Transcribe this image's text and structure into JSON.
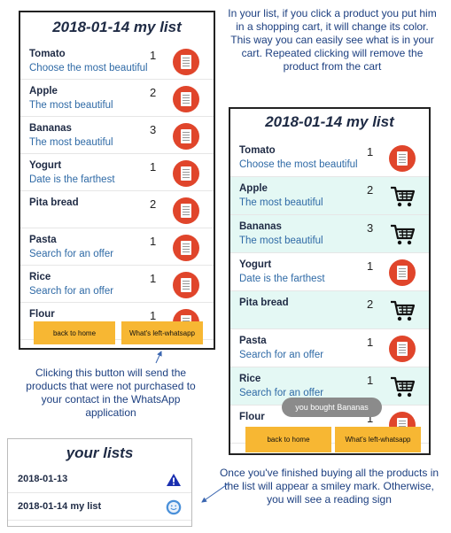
{
  "colors": {
    "incart_bg": "#e4f8f4",
    "button": "#f7b733",
    "doc_icon": "#e0452b",
    "annotation": "#1c3f80",
    "title": "#1e2a44",
    "note": "#2f6aa6"
  },
  "left_phone": {
    "title": "2018-01-14  my list",
    "items": [
      {
        "name": "Tomato",
        "note": "Choose the most beautiful",
        "qty": "1",
        "icon": "doc-icon"
      },
      {
        "name": "Apple",
        "note": "The most beautiful",
        "qty": "2",
        "icon": "doc-icon"
      },
      {
        "name": "Bananas",
        "note": "The most beautiful",
        "qty": "3",
        "icon": "doc-icon"
      },
      {
        "name": "Yogurt",
        "note": "Date is the farthest",
        "qty": "1",
        "icon": "doc-icon"
      },
      {
        "name": "Pita bread",
        "note": "",
        "qty": "2",
        "icon": "doc-icon"
      },
      {
        "name": "Pasta",
        "note": "Search for an offer",
        "qty": "1",
        "icon": "doc-icon"
      },
      {
        "name": "Rice",
        "note": "Search for an offer",
        "qty": "1",
        "icon": "doc-icon"
      },
      {
        "name": "Flour",
        "note": "",
        "qty": "1",
        "icon": "doc-icon"
      }
    ],
    "buttons": {
      "home": "back to home",
      "whatsapp": "What's left-whatsapp"
    }
  },
  "right_phone": {
    "title": "2018-01-14  my list",
    "items": [
      {
        "name": "Tomato",
        "note": "Choose the most beautiful",
        "qty": "1",
        "icon": "doc-icon",
        "in_cart": false
      },
      {
        "name": "Apple",
        "note": "The most beautiful",
        "qty": "2",
        "icon": "cart-icon",
        "in_cart": true
      },
      {
        "name": "Bananas",
        "note": "The most beautiful",
        "qty": "3",
        "icon": "cart-icon",
        "in_cart": true
      },
      {
        "name": "Yogurt",
        "note": "Date is the farthest",
        "qty": "1",
        "icon": "doc-icon",
        "in_cart": false
      },
      {
        "name": "Pita bread",
        "note": "",
        "qty": "2",
        "icon": "cart-icon",
        "in_cart": true
      },
      {
        "name": "Pasta",
        "note": "Search for an offer",
        "qty": "1",
        "icon": "doc-icon",
        "in_cart": false
      },
      {
        "name": "Rice",
        "note": "Search for an offer",
        "qty": "1",
        "icon": "cart-icon",
        "in_cart": true
      },
      {
        "name": "Flour",
        "note": "",
        "qty": "1",
        "icon": "doc-icon",
        "in_cart": false
      }
    ],
    "toast": "you bought Bananas",
    "buttons": {
      "home": "back to home",
      "whatsapp": "What's left-whatsapp"
    }
  },
  "lists_panel": {
    "title": "your lists",
    "rows": [
      {
        "label": "2018-01-13",
        "status_icon": "warning-icon"
      },
      {
        "label": "2018-01-14  my list",
        "status_icon": "smiley-icon"
      }
    ]
  },
  "annotations": {
    "top": "In your list, if you click a product you put him in a shopping cart, it will change its color. This way you can easily see what is in your cart. Repeated clicking will remove the product from the cart",
    "middle": "Clicking this button will send the products that were not purchased to your contact in the WhatsApp application",
    "bottom": "Once you've finished buying all the products in the list will appear a smiley mark. Otherwise, you will see a reading sign"
  }
}
